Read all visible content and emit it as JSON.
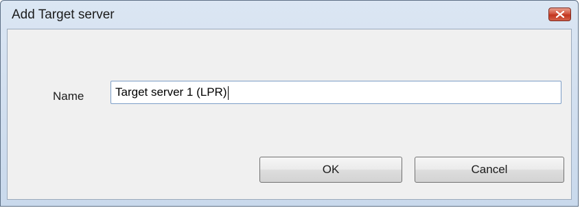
{
  "window": {
    "title": "Add Target server",
    "close_icon": "close-icon"
  },
  "form": {
    "name_label": "Name",
    "name_value": "Target server 1 (LPR)"
  },
  "buttons": {
    "ok_label": "OK",
    "cancel_label": "Cancel"
  },
  "colors": {
    "close_button": "#c2351e",
    "titlebar": "#c9d9ec",
    "client": "#f0f0f0",
    "input_border": "#7a9cc6"
  }
}
